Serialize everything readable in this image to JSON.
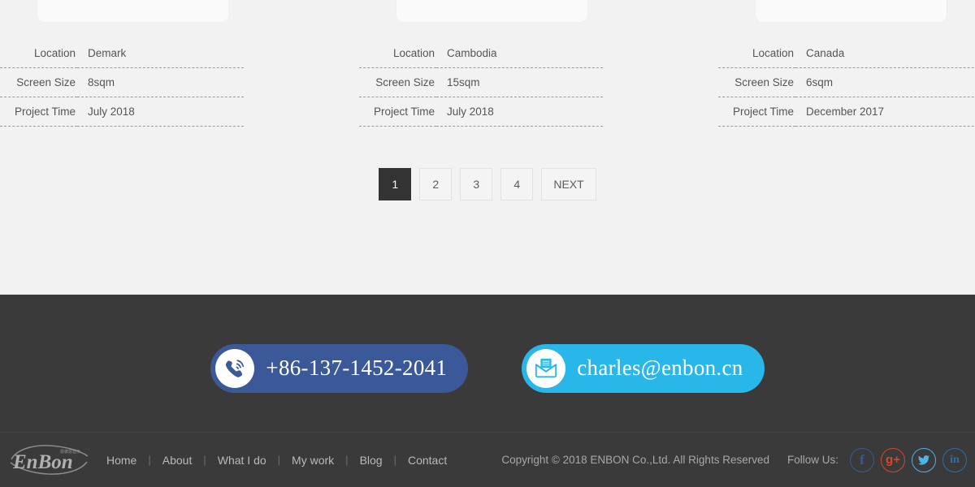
{
  "projects": [
    {
      "rows": [
        {
          "label": "Location",
          "value": "Demark"
        },
        {
          "label": "Screen Size",
          "value": "8sqm"
        },
        {
          "label": "Project Time",
          "value": "July 2018"
        }
      ]
    },
    {
      "rows": [
        {
          "label": "Location",
          "value": "Cambodia"
        },
        {
          "label": "Screen Size",
          "value": "15sqm"
        },
        {
          "label": "Project Time",
          "value": "July 2018"
        }
      ]
    },
    {
      "rows": [
        {
          "label": "Location",
          "value": "Canada"
        },
        {
          "label": "Screen Size",
          "value": "6sqm"
        },
        {
          "label": "Project Time",
          "value": "December 2017"
        }
      ]
    }
  ],
  "pagination": {
    "pages": [
      "1",
      "2",
      "3",
      "4"
    ],
    "active": "1",
    "next_label": "NEXT"
  },
  "contact": {
    "phone": {
      "label": "+86-137-1452-2041",
      "icon": "phone-icon",
      "color": "#3b5998"
    },
    "email": {
      "label": "charles@enbon.cn",
      "icon": "envelope-icon",
      "color": "#29b6e8"
    }
  },
  "footer": {
    "logo_text": "EnBon",
    "logo_sub": "恩彼恩显示",
    "nav": [
      "Home",
      "About",
      "What I do",
      "My work",
      "Blog",
      "Contact"
    ],
    "separator": "|",
    "copyright": "Copyright © 2018 ENBON Co.,Ltd. All Rights Reserved",
    "follow_label": "Follow Us:",
    "socials": [
      {
        "name": "facebook",
        "glyph": "f",
        "color": "#3b5998"
      },
      {
        "name": "google-plus",
        "glyph": "g+",
        "color": "#d9442e"
      },
      {
        "name": "twitter",
        "glyph": "",
        "color": "#4cb4e8"
      },
      {
        "name": "linkedin",
        "glyph": "in",
        "color": "#2d6ea8"
      }
    ]
  }
}
